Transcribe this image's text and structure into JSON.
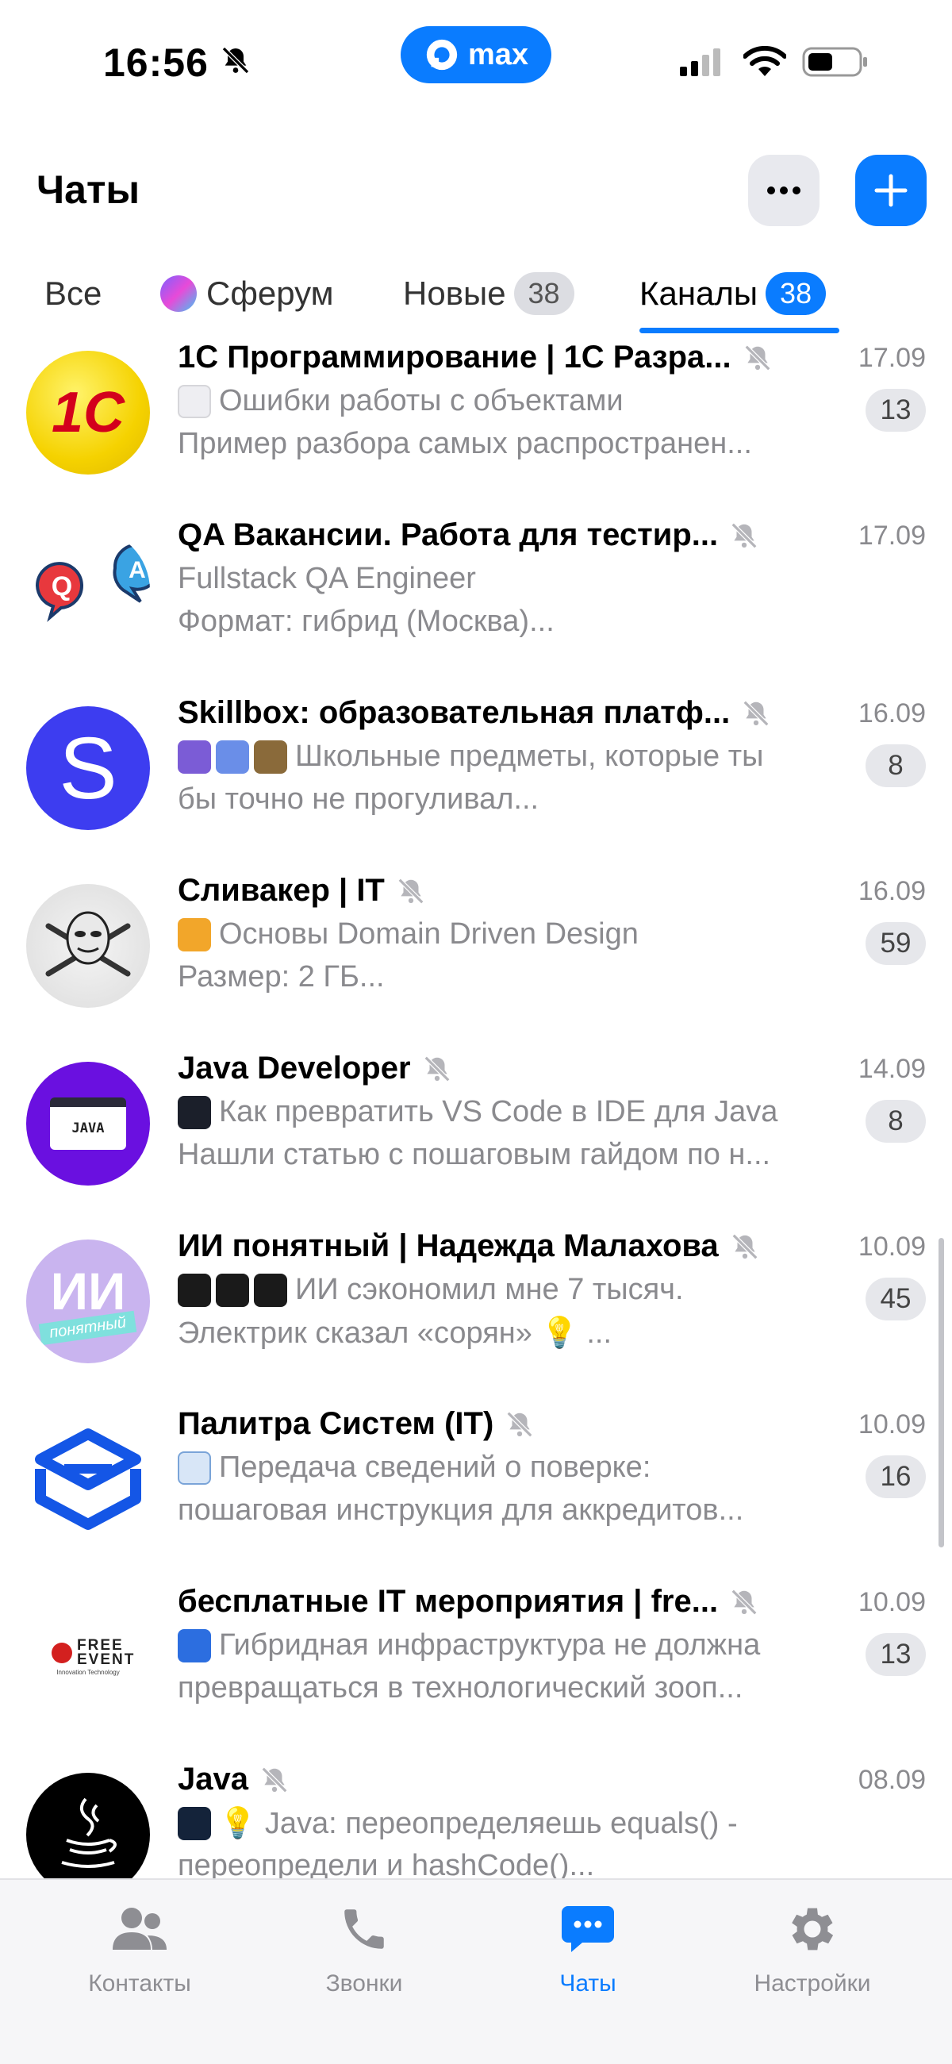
{
  "status_bar": {
    "time": "16:56",
    "app_pill": "max"
  },
  "header": {
    "title": "Чаты"
  },
  "tabs": [
    {
      "label": "Все",
      "count": ""
    },
    {
      "label": "Сферум",
      "count": ""
    },
    {
      "label": "Новые",
      "count": "38"
    },
    {
      "label": "Каналы",
      "count": "38",
      "active": true
    }
  ],
  "chats": [
    {
      "name": "1С Программирование | 1С Разра...",
      "date": "17.09",
      "line1": "Ошибки работы с объектами",
      "line2": "Пример разбора самых распространен...",
      "badge": "13"
    },
    {
      "name": "QA Вакансии. Работа для тестир...",
      "date": "17.09",
      "line1": "Fullstack QA Engineer",
      "line2": "Формат: гибрид (Москва)...",
      "badge": ""
    },
    {
      "name": "Skillbox: образовательная платф...",
      "date": "16.09",
      "line1": "Школьные предметы, которые ты",
      "line2": "бы точно не прогуливал...",
      "badge": "8"
    },
    {
      "name": "Сливакер | IT",
      "date": "16.09",
      "line1": "Основы Domain Driven Design",
      "line2": "Размер: 2 ГБ...",
      "badge": "59"
    },
    {
      "name": "Java Developer",
      "date": "14.09",
      "line1": "Как превратить VS Code в IDE для Java",
      "line2": "Нашли статью с пошаговым гайдом по н...",
      "badge": "8"
    },
    {
      "name": "ИИ понятный | Надежда Малахова",
      "date": "10.09",
      "line1": "ИИ сэкономил мне 7 тысяч.",
      "line2": "Электрик сказал «сорян» 💡 ...",
      "badge": "45"
    },
    {
      "name": "Палитра Систем (IT)",
      "date": "10.09",
      "line1": "Передача сведений о поверке:",
      "line2": "пошаговая инструкция для аккредитов...",
      "badge": "16"
    },
    {
      "name": "бесплатные IT мероприятия | fre...",
      "date": "10.09",
      "line1": "Гибридная инфраструктура не должна",
      "line2": "превращаться в технологический зооп...",
      "badge": "13"
    },
    {
      "name": "Java",
      "date": "08.09",
      "line1": "💡 Java: переопределяешь equals() -",
      "line2": "переопредели и hashCode()...",
      "badge": ""
    }
  ],
  "avatars": {
    "c1": "1С",
    "qa_q": "Q",
    "qa_a": "A",
    "skillbox": "S",
    "ai_big": "ИИ",
    "ai_small": "понятный",
    "free_event": "FREE EVENT",
    "free_event_sub": "Innovation Technology",
    "java_code": "JAVA"
  },
  "bottom_nav": [
    {
      "label": "Контакты"
    },
    {
      "label": "Звонки"
    },
    {
      "label": "Чаты",
      "active": true
    },
    {
      "label": "Настройки"
    }
  ],
  "colors": {
    "accent": "#0a7cff",
    "muted": "#8a8a8e"
  }
}
